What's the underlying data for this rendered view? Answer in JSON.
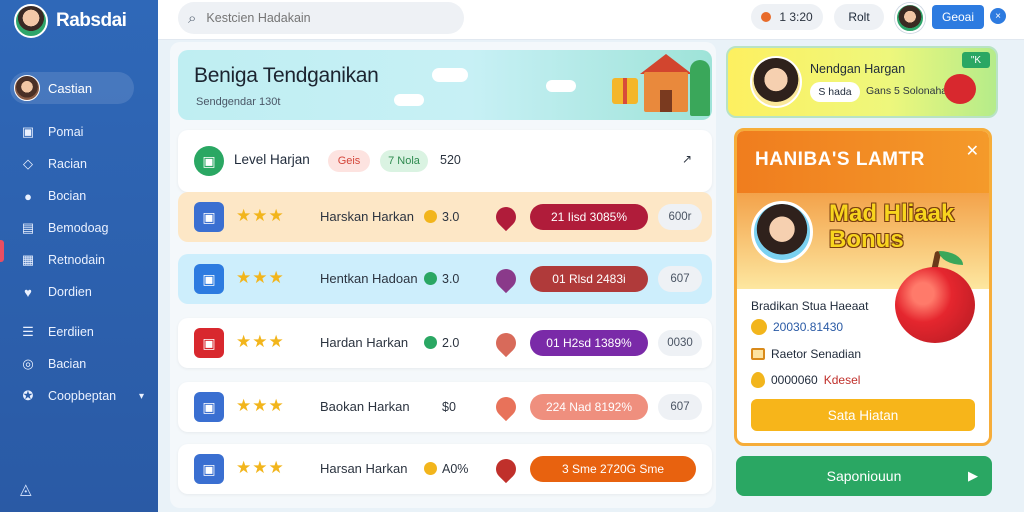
{
  "brand": {
    "name": "Rabsdai"
  },
  "sidebar": {
    "user": "Castian",
    "items": [
      {
        "label": "Pomai",
        "icon": "inbox-icon"
      },
      {
        "label": "Racian",
        "icon": "tag-icon"
      },
      {
        "label": "Bocian",
        "icon": "user-icon"
      },
      {
        "label": "Bemodoag",
        "icon": "document-icon"
      },
      {
        "label": "Retnodain",
        "icon": "grid-icon"
      },
      {
        "label": "Dordien",
        "icon": "heart-icon"
      },
      {
        "label": "Eerdiien",
        "icon": "list-icon"
      },
      {
        "label": "Bacian",
        "icon": "circle-icon"
      },
      {
        "label": "Coopbeptan",
        "icon": "globe-icon"
      }
    ]
  },
  "topbar": {
    "search_placeholder": "Kestcien Hadakain",
    "coins": "1 3:20",
    "bell_label": "Rolt",
    "cta_label": "Geoai",
    "close": "×"
  },
  "hero": {
    "title": "Beniga Tendganikan",
    "subtitle": "Sendgendar 130t"
  },
  "level": {
    "title": "Level Harjan",
    "chip_red": "Geis",
    "chip_green": "7 Nola",
    "value": "520",
    "more": "↗"
  },
  "rows": [
    {
      "name": "Harskan Harkan",
      "value": "3.0",
      "pill": "21 Iisd 3085%",
      "tag": "600r",
      "coin_color": "#f2b51c",
      "pill_color": "#b01c3a",
      "bg": "#fde7c6",
      "icon_color": "#3a6fd1",
      "shape_color": "#b01c3a"
    },
    {
      "name": "Hentkan Hadoan",
      "value": "3.0",
      "pill": "01 Rlsd 2483i",
      "tag": "607",
      "coin_color": "#2aa763",
      "pill_color": "#b03a3a",
      "bg": "#cdeefc",
      "icon_color": "#2d7be0",
      "shape_color": "#8a3a8a"
    },
    {
      "name": "Hardan Harkan",
      "value": "2.0",
      "pill": "01 H2sd 1389%",
      "tag": "0030",
      "coin_color": "#2aa763",
      "pill_color": "#7a2aa8",
      "bg": "#ffffff",
      "icon_color": "#d8282e",
      "shape_color": "#d86a5a"
    },
    {
      "name": "Baokan Harkan",
      "value": "$0",
      "pill": "224 Nad 8192%",
      "tag": "607",
      "coin_color": "#ffffff",
      "pill_color": "#ef8f7e",
      "bg": "#ffffff",
      "icon_color": "#3a6fd1",
      "shape_color": "#e8725a"
    },
    {
      "name": "Harsan Harkan",
      "value": "A0%",
      "pill": "3 Sme 2720G  Sme",
      "tag": "",
      "coin_color": "#f2b51c",
      "pill_color": "#e8620f",
      "bg": "#ffffff",
      "icon_color": "#3a6fd1",
      "shape_color": "#c0302b"
    }
  ],
  "promo": {
    "title": "Nendgan Hargan",
    "chip": "S hada",
    "note": "Gans 5 Solonaha",
    "badge": "\"K"
  },
  "bonus": {
    "title": "HANIBA'S LAMTR",
    "big_line1": "Mad Hliaak",
    "big_line2": "Bonus",
    "desc": "Bradikan Stua Haeaat",
    "line1": "20030.81430",
    "line2": "Raetor Senadian",
    "line3_a": "0000060 ",
    "line3_b": "Kdesel",
    "button": "Sata Hiatan",
    "cta": "Saponiouun"
  }
}
